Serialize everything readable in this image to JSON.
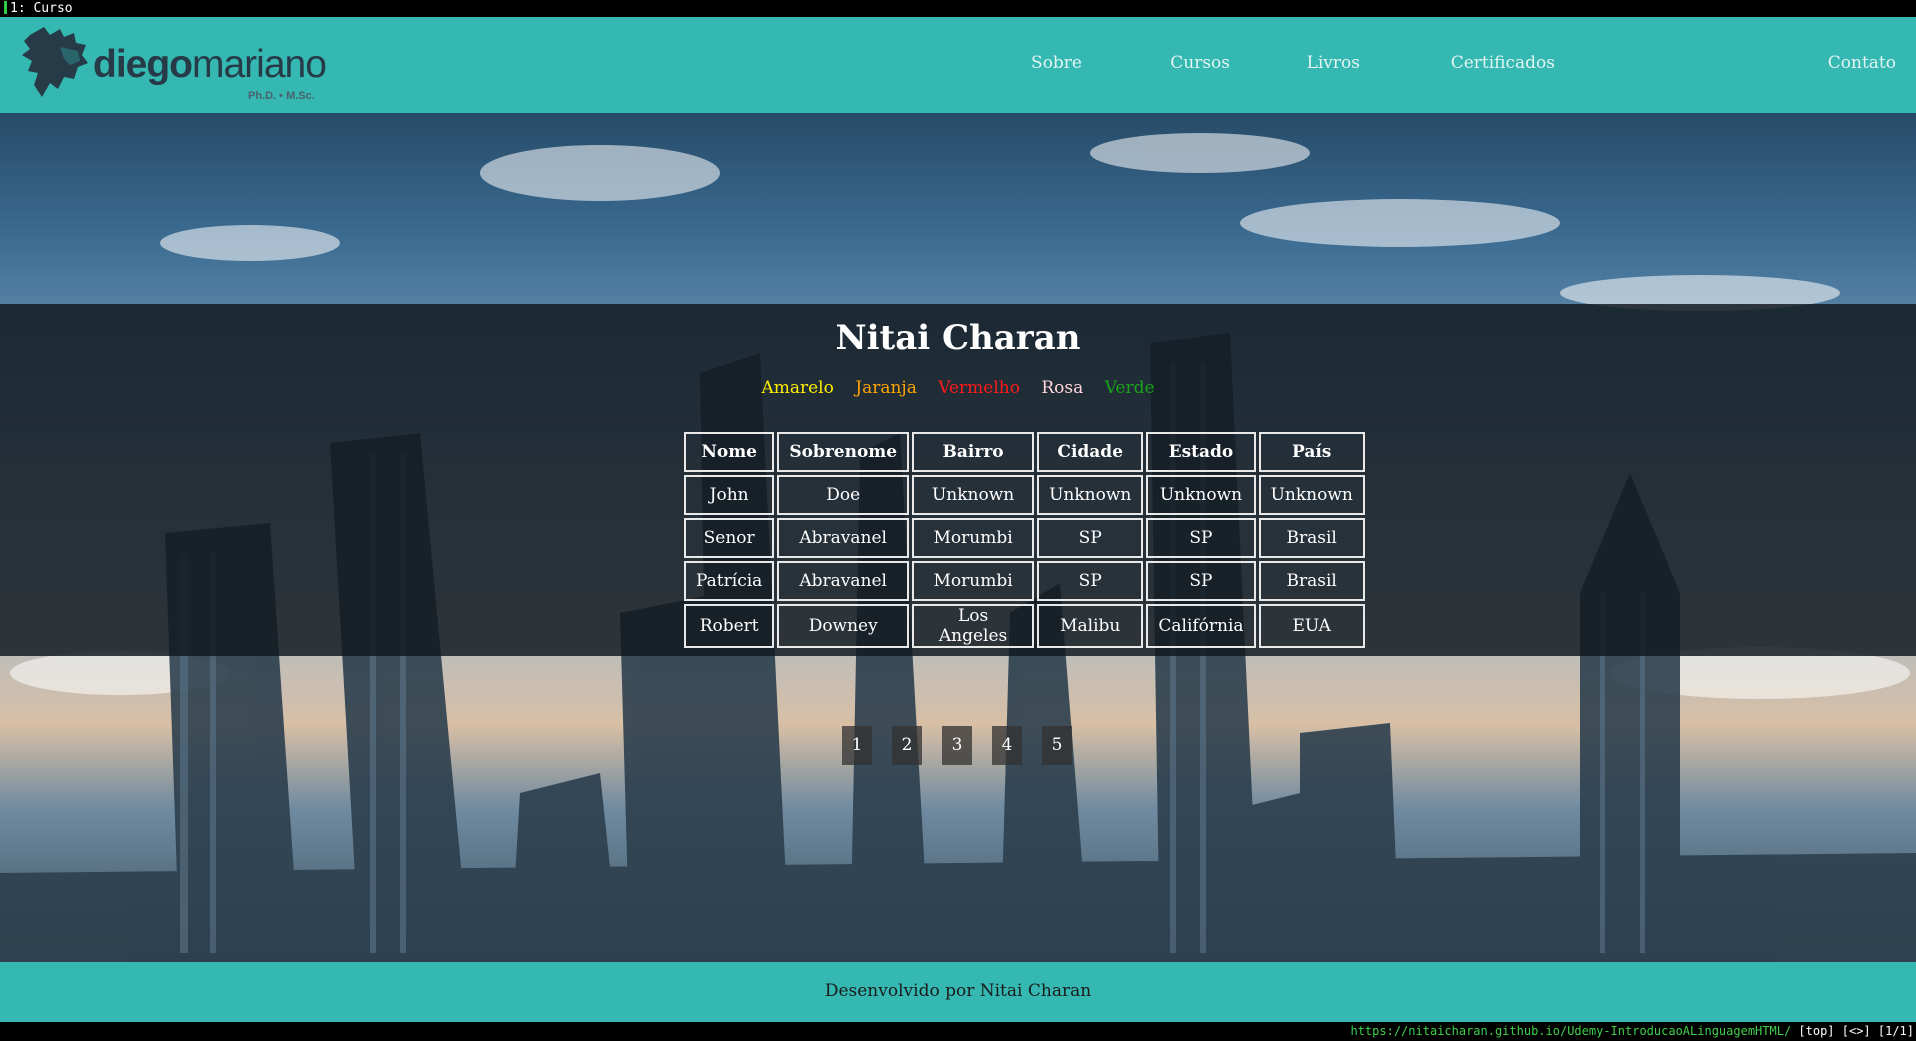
{
  "terminal": {
    "title": "1: Curso"
  },
  "brand": {
    "name_bold": "diego",
    "name_regular": "mariano",
    "subtitle": "Ph.D. • M.Sc."
  },
  "nav": [
    {
      "label": "Sobre"
    },
    {
      "label": "Cursos"
    },
    {
      "label": "Livros"
    },
    {
      "label": "Certificados"
    },
    {
      "label": "Contato"
    }
  ],
  "main": {
    "title": "Nitai Charan",
    "colors": [
      {
        "label": "Amarelo",
        "color": "#ffee00"
      },
      {
        "label": "Jaranja",
        "color": "#ffa500"
      },
      {
        "label": "Vermelho",
        "color": "#ff1a1a"
      },
      {
        "label": "Rosa",
        "color": "#ffd6da"
      },
      {
        "label": "Verde",
        "color": "#1aa31a"
      }
    ],
    "table": {
      "headers": [
        "Nome",
        "Sobrenome",
        "Bairro",
        "Cidade",
        "Estado",
        "País"
      ],
      "rows": [
        [
          "John",
          "Doe",
          "Unknown",
          "Unknown",
          "Unknown",
          "Unknown"
        ],
        [
          "Senor",
          "Abravanel",
          "Morumbi",
          "SP",
          "SP",
          "Brasil"
        ],
        [
          "Patrícia",
          "Abravanel",
          "Morumbi",
          "SP",
          "SP",
          "Brasil"
        ],
        [
          "Robert",
          "Downey",
          "Los Angeles",
          "Malibu",
          "Califórnia",
          "EUA"
        ]
      ]
    },
    "pagination": [
      "1",
      "2",
      "3",
      "4",
      "5"
    ]
  },
  "footer": {
    "text": "Desenvolvido por Nitai Charan"
  },
  "statusbar": {
    "url": "https://nitaicharan.github.io/Udemy-IntroducaoALinguagemHTML/",
    "info": "[top] [<>] [1/1]"
  }
}
